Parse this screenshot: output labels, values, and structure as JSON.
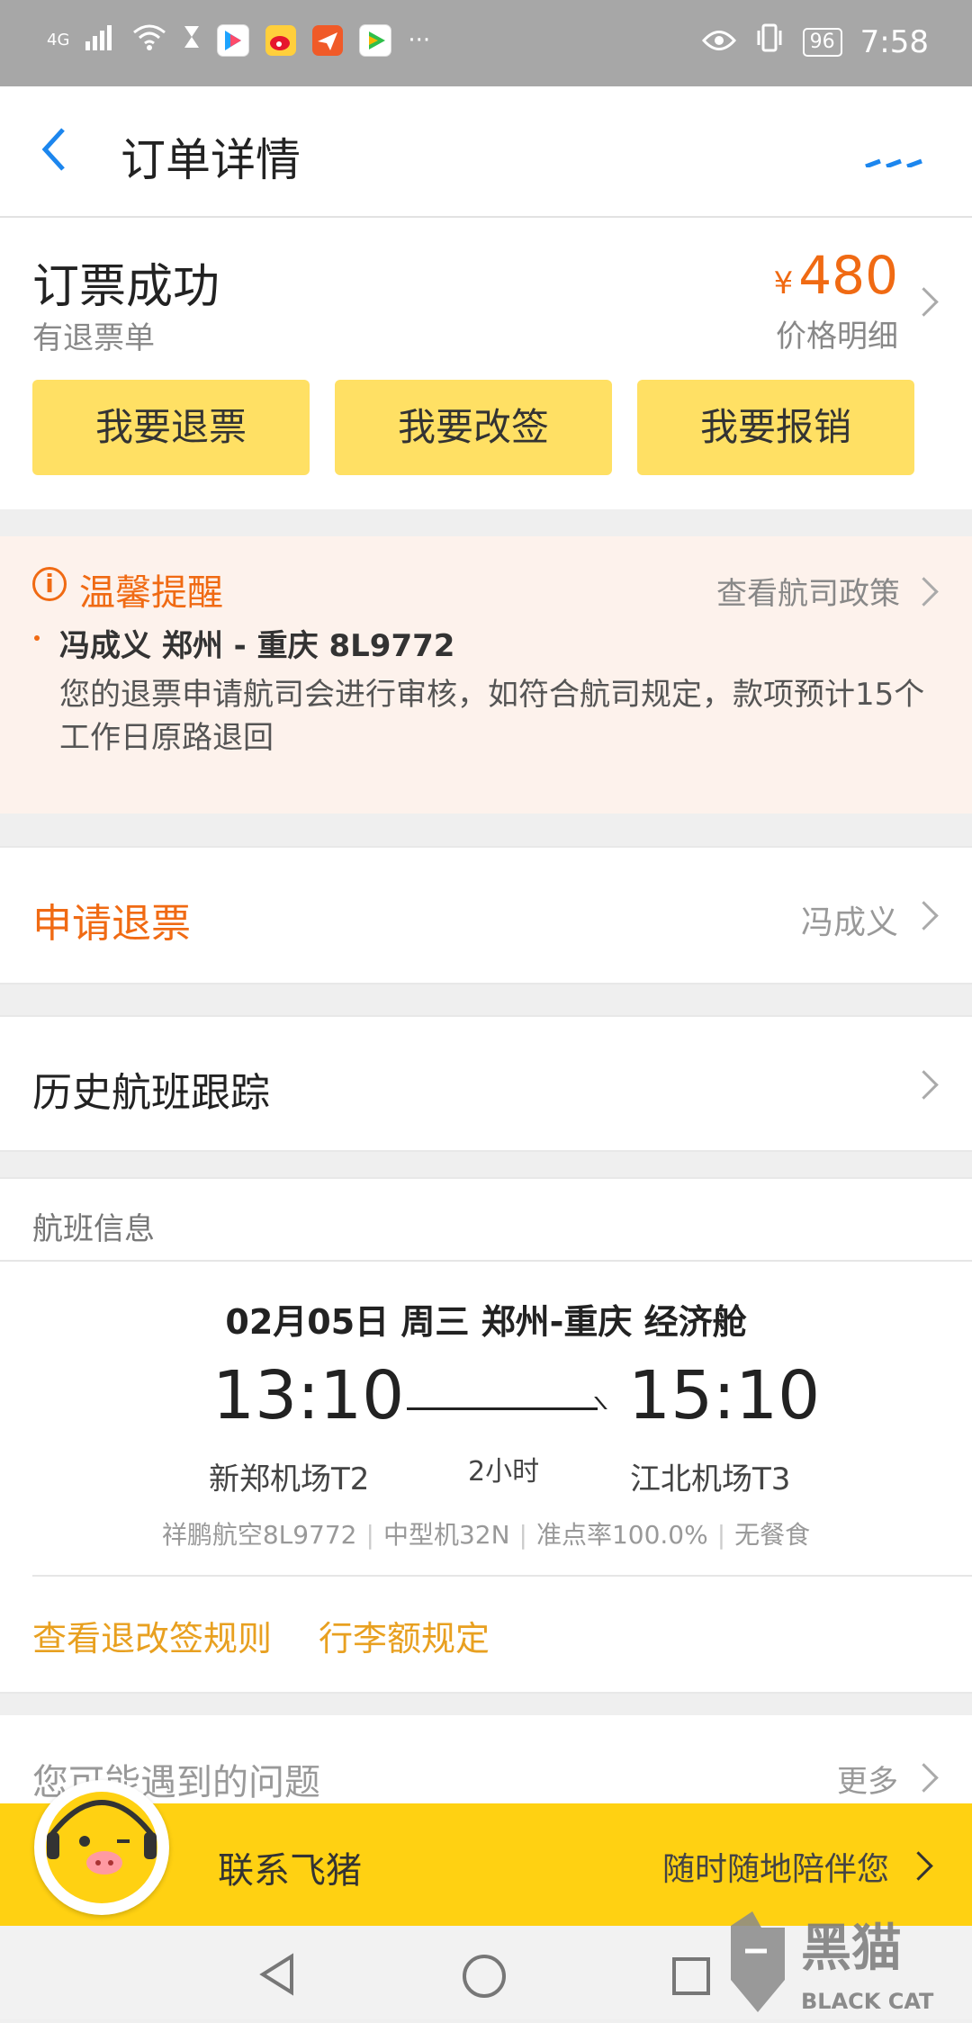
{
  "status_bar": {
    "network": "4G",
    "battery": "96",
    "time": "7:58"
  },
  "nav": {
    "title": "订单详情",
    "more": "..."
  },
  "order_status": {
    "title": "订票成功",
    "subtitle": "有退票单",
    "currency": "¥",
    "price": "480",
    "price_label": "价格明细",
    "buttons": [
      "我要退票",
      "我要改签",
      "我要报销"
    ]
  },
  "notice": {
    "title": "温馨提醒",
    "policy_link": "查看航司政策",
    "passenger_route": "冯成义 郑州 - 重庆 8L9772",
    "message": "您的退票申请航司会进行审核，如符合航司规定，款项预计15个工作日原路退回"
  },
  "refund_row": {
    "label": "申请退票",
    "value": "冯成义"
  },
  "history_row": {
    "label": "历史航班跟踪"
  },
  "flight": {
    "header": "航班信息",
    "date_line": "02月05日 周三 郑州-重庆 经济舱",
    "dep_time": "13:10",
    "arr_time": "15:10",
    "duration": "2小时",
    "dep_airport": "新郑机场T2",
    "arr_airport": "江北机场T3",
    "meta": [
      "祥鹏航空8L9772",
      "中型机32N",
      "准点率100.0%",
      "无餐食"
    ],
    "link_rules": "查看退改签规则",
    "link_baggage": "行李额规定"
  },
  "faq": {
    "label": "您可能遇到的问题",
    "more": "更多"
  },
  "contact": {
    "label": "联系飞猪",
    "right": "随时随地陪伴您"
  },
  "watermark": {
    "cn": "黑猫",
    "en": "BLACK CAT"
  },
  "colors": {
    "accent_orange": "#f06a13",
    "button_yellow": "#ffe064",
    "contact_yellow": "#ffd112",
    "link_blue": "#1c86ee",
    "link_gold": "#e8a020"
  }
}
